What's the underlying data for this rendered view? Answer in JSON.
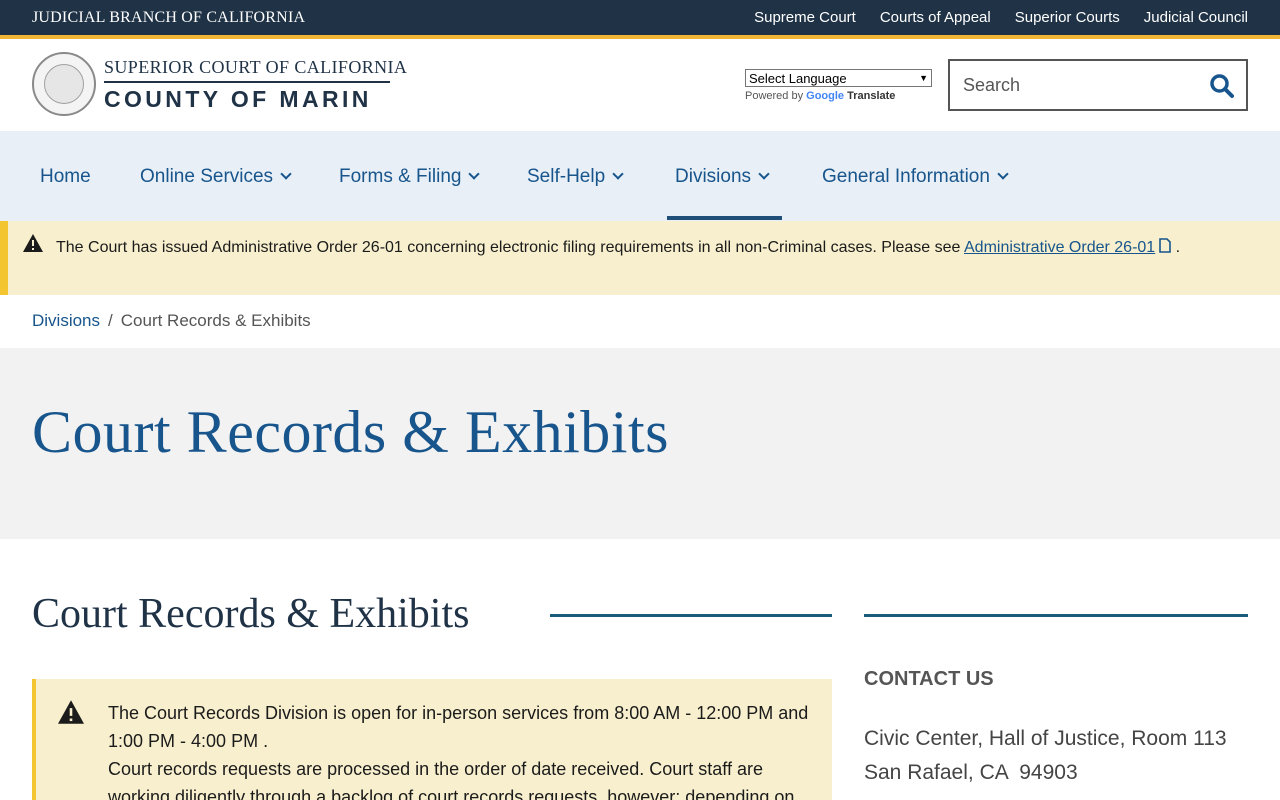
{
  "topbar": {
    "brand": "JUDICIAL BRANCH OF CALIFORNIA",
    "links": [
      "Supreme Court",
      "Courts of Appeal",
      "Superior Courts",
      "Judicial Council"
    ]
  },
  "header": {
    "line1": "SUPERIOR COURT OF CALIFORNIA",
    "line2": "COUNTY OF MARIN",
    "language_select": "Select Language",
    "powered_by": "Powered by",
    "google": "Google",
    "translate": "Translate",
    "search_placeholder": "Search"
  },
  "nav": {
    "items": [
      {
        "label": "Home"
      },
      {
        "label": "Online Services"
      },
      {
        "label": "Forms & Filing"
      },
      {
        "label": "Self-Help"
      },
      {
        "label": "Divisions"
      },
      {
        "label": "General Information"
      }
    ],
    "active": "Divisions"
  },
  "alert": {
    "text": "The Court has issued Administrative Order 26-01 concerning electronic filing requirements in all non-Criminal cases. Please see ",
    "link": "Administrative Order 26-01",
    "end": " ."
  },
  "breadcrumb": {
    "parent": "Divisions",
    "separator": "/",
    "current": "Court Records & Exhibits"
  },
  "hero": {
    "title": "Court Records & Exhibits"
  },
  "main": {
    "section_title": "Court Records & Exhibits",
    "notice_line1": "The Court Records Division is open for in-person services from 8:00 AM - 12:00 PM and 1:00 PM - 4:00 PM .",
    "notice_line2": "Court records requests are processed in the order of date received. Court staff are working diligently through a backlog of court records requests, however; depending on the nature of"
  },
  "contact": {
    "heading": "CONTACT US",
    "address1": "Civic Center, Hall of Justice, Room 113",
    "address2": "San Rafael, CA  94903"
  },
  "colors": {
    "topbar": "#1f3246",
    "accent": "#f2b634",
    "link": "#17558c",
    "alert_bg": "#f7efcd"
  }
}
